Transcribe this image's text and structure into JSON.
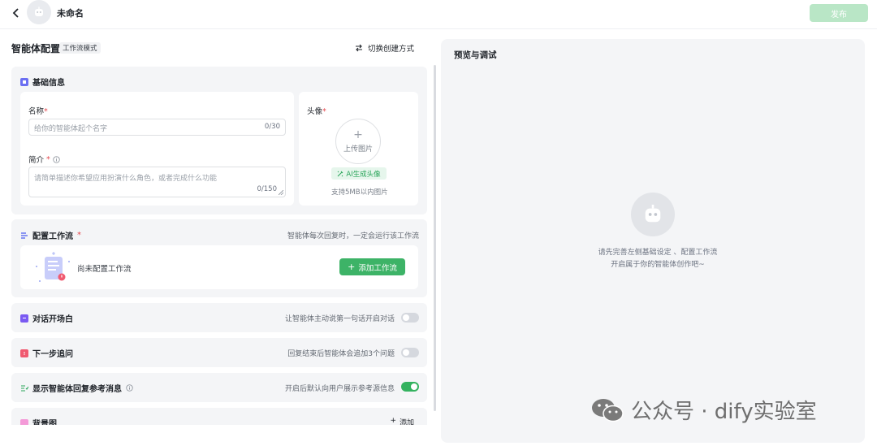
{
  "header": {
    "back_icon": "chevron-left-icon",
    "app_name": "未命名",
    "publish_label": "发布"
  },
  "config": {
    "title": "智能体配置",
    "mode_tag": "工作流模式",
    "switch_label": "切换创建方式",
    "basic": {
      "title": "基础信息",
      "name_label": "名称",
      "name_placeholder": "给你的智能体起个名字",
      "name_counter": "0/30",
      "intro_label": "简介",
      "intro_placeholder": "请简单描述你希望应用扮演什么角色，或者完成什么功能",
      "intro_counter": "0/150",
      "avatar_label": "头像",
      "upload_label": "上传图片",
      "ai_avatar_label": "AI生成头像",
      "upload_hint": "支持5MB以内图片"
    },
    "workflow": {
      "title": "配置工作流",
      "desc": "智能体每次回复时，一定会运行该工作流",
      "empty_text": "尚未配置工作流",
      "add_label": "添加工作流"
    },
    "opening": {
      "title": "对话开场白",
      "desc": "让智能体主动说第一句话开启对话",
      "enabled": false
    },
    "followup": {
      "title": "下一步追问",
      "desc": "回复结束后智能体会追加3个问题",
      "enabled": false
    },
    "reference": {
      "title": "显示智能体回复参考消息",
      "desc": "开启后默认向用户展示参考源信息",
      "enabled": true
    },
    "background": {
      "title": "背景图",
      "add_label": "添加"
    }
  },
  "preview": {
    "title": "预览与调试",
    "message_line1": "请先完善左侧基础设定 、配置工作流",
    "message_line2": "开启属于你的智能体创作吧~"
  },
  "watermark": {
    "text": "公众号 · dify实验室"
  },
  "colors": {
    "accent": "#3db367",
    "publish_disabled": "#b9e6c6",
    "required": "#e5484d"
  }
}
